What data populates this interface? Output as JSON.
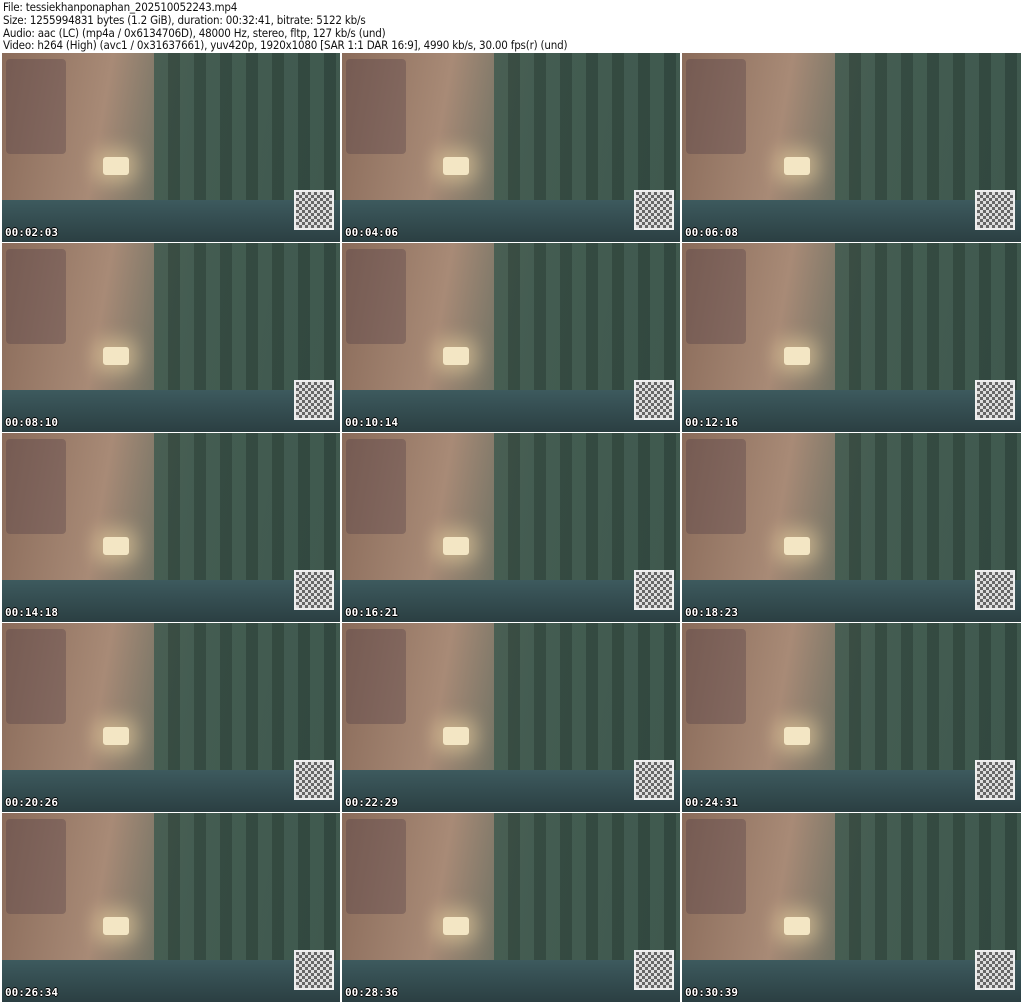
{
  "header": {
    "file": "File: tessiekhanponaphan_202510052243.mp4",
    "size": "Size: 1255994831 bytes (1.2 GiB), duration: 00:32:41, bitrate: 5122 kb/s",
    "audio": "Audio: aac (LC) (mp4a / 0x6134706D), 48000 Hz, stereo, fltp, 127 kb/s (und)",
    "video": "Video: h264 (High) (avc1 / 0x31637661), yuv420p, 1920x1080 [SAR 1:1 DAR 16:9], 4990 kb/s, 30.00 fps(r) (und)"
  },
  "frames": [
    "00:02:03",
    "00:04:06",
    "00:06:08",
    "00:08:10",
    "00:10:14",
    "00:12:16",
    "00:14:18",
    "00:16:21",
    "00:18:23",
    "00:20:26",
    "00:22:29",
    "00:24:31",
    "00:26:34",
    "00:28:36",
    "00:30:39"
  ]
}
